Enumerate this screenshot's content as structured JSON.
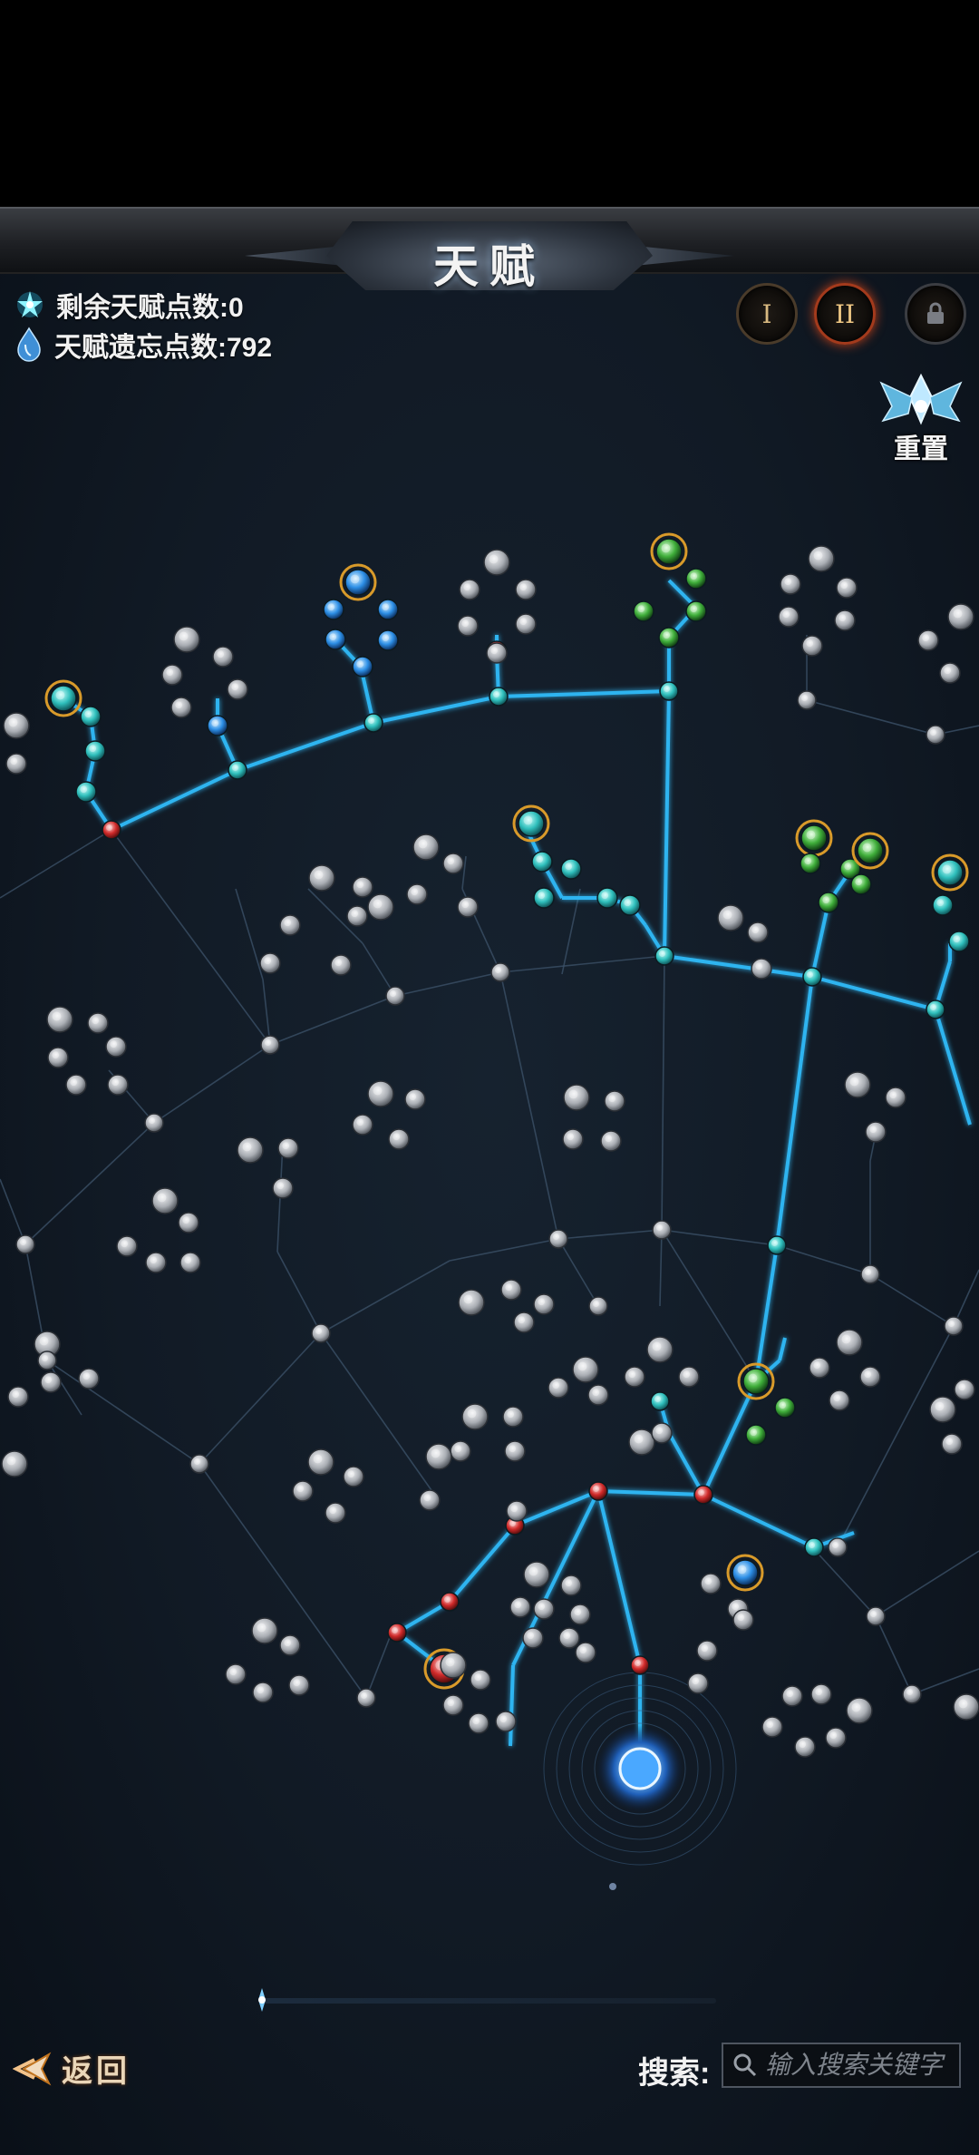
{
  "header": {
    "title": "天赋"
  },
  "stats": {
    "remaining_points_label": "剩余天赋点数:0",
    "forget_points_label": "天赋遗忘点数:792",
    "remaining_icon": "talent-star-icon",
    "forget_icon": "crystal-drop-icon"
  },
  "pages": [
    {
      "label": "I",
      "state": "normal"
    },
    {
      "label": "II",
      "state": "selected"
    },
    {
      "label": "",
      "state": "locked",
      "icon": "lock-icon"
    }
  ],
  "reset": {
    "label": "重置",
    "icon": "winged-crest-icon"
  },
  "footer": {
    "back_label": "返回",
    "search_label": "搜索:",
    "search_placeholder": "输入搜索关键字"
  },
  "colors": {
    "active_line": "#2fb4f0",
    "inactive_line": "#3b5066",
    "red_node": "#d02a2a",
    "teal_node": "#36c6c2",
    "gray_node": "#b8bcc2",
    "gold_ring": "#d89a2a"
  }
}
